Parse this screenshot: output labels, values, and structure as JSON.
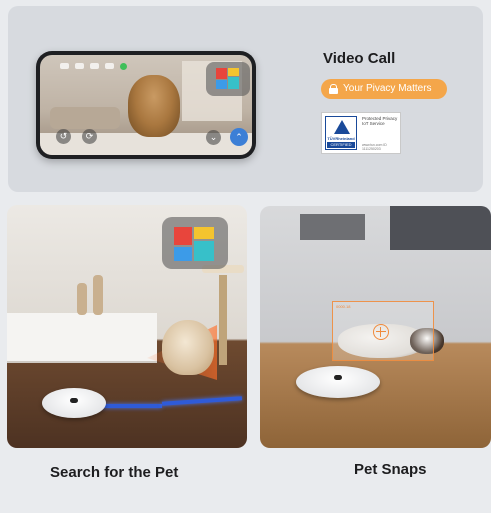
{
  "video_call": {
    "title": "Video Call",
    "privacy_badge": "Your Pivacy Matters",
    "badge_color": "#f4a64a",
    "certificate": {
      "logo_text": "TÜVRheinland",
      "logo_bar": "CERTIFIED",
      "lines": "Protected Privacy IoT Service",
      "url": "www.tuv.com ID 1111250203"
    }
  },
  "features": [
    {
      "caption": "Search for the Pet"
    },
    {
      "caption": "Pet Snaps"
    }
  ],
  "icons": {
    "lock": "lock-icon",
    "camera": "camera-tile-icon",
    "robot": "robot-vacuum",
    "target": "crosshair-icon"
  }
}
